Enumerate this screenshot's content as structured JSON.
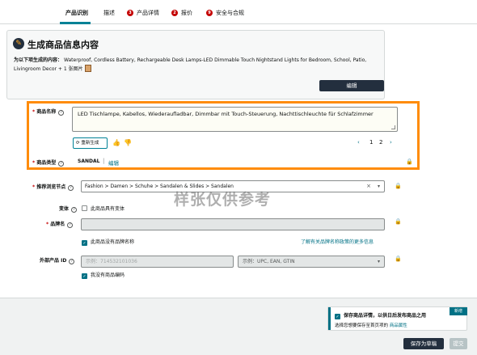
{
  "tabs": [
    {
      "label": "产品识别",
      "active": true,
      "error": ""
    },
    {
      "label": "描述",
      "active": false,
      "error": ""
    },
    {
      "label": "产品详情",
      "active": false,
      "error": "3"
    },
    {
      "label": "报价",
      "active": false,
      "error": "2"
    },
    {
      "label": "安全与合规",
      "active": false,
      "error": "9"
    }
  ],
  "generator": {
    "title": "生成商品信息内容",
    "desc_prefix": "为以下项生成的内容：",
    "desc_text": "Waterproof, Cordless Battery, Rechargeable Desk Lamps-LED Dimmable Touch Nightstand Lights for Bedroom, School, Patio, Livingroom Decor + 1 张图片",
    "edit_label": "编辑"
  },
  "product_name": {
    "label": "商品名称",
    "value": "LED Tischlampe, Kabellos, Wiederaufladbar, Dimmbar mit Touch-Steuerung, Nachttischleuchte für Schlafzimmer",
    "regen_label": "重新生成",
    "pages": [
      "1",
      "2"
    ],
    "prev": "‹",
    "next": "›"
  },
  "product_type": {
    "label": "商品类型",
    "value": "SANDAL",
    "edit_link": "编辑"
  },
  "browse_node": {
    "label": "推荐浏览节点",
    "value": "Fashion > Damen > Schuhe > Sandalen & Slides > Sandalen"
  },
  "variation": {
    "label": "变体",
    "checkbox_label": "此商品具有变体"
  },
  "brand": {
    "label": "品牌名",
    "no_brand_label": "此商品没有品牌名称",
    "policy_link": "了解有关品牌名称政策的更多信息"
  },
  "external_id": {
    "label": "外部产品 ID",
    "value": "示例：714532101036",
    "type_placeholder": "示例：UPC, EAN, GTIN",
    "no_code_label": "我没有商品编码"
  },
  "watermark": "样张仅供参考",
  "footer": {
    "notice_title": "保存商品详情，以供日后发布商品之用",
    "notice_text": "选择您想要保存至首页项的",
    "notice_link": "商品属性",
    "new_badge": "新增",
    "save_draft": "保存为草稿",
    "submit": "提交"
  },
  "colors": {
    "accent": "#008296",
    "highlight": "#ff8c0a",
    "primary_button": "#232f3e",
    "error": "#c40000"
  }
}
